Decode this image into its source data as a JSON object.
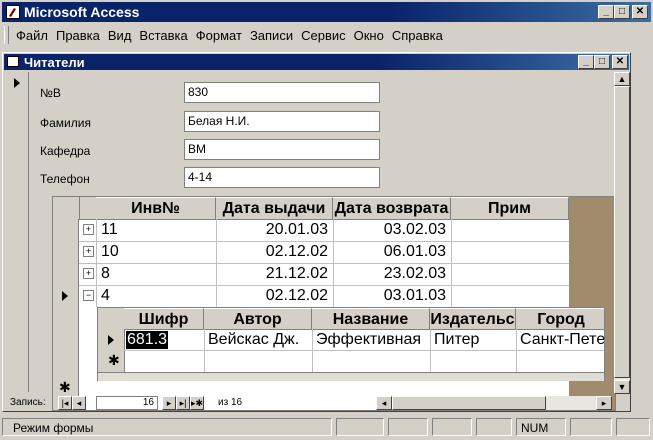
{
  "app": {
    "title": "Microsoft Access"
  },
  "menu": [
    "Файл",
    "Правка",
    "Вид",
    "Вставка",
    "Формат",
    "Записи",
    "Сервис",
    "Окно",
    "Справка"
  ],
  "form": {
    "title": "Читатели",
    "fields": [
      {
        "label": "№В",
        "value": "830"
      },
      {
        "label": "Фамилия",
        "value": "Белая Н.И."
      },
      {
        "label": "Кафедра",
        "value": "ВМ"
      },
      {
        "label": "Телефон",
        "value": "4-14"
      }
    ]
  },
  "subform": {
    "columns": [
      "Инв№",
      "Дата выдачи",
      "Дата возврата",
      "Прим"
    ],
    "rows": [
      {
        "expander": "+",
        "inv": "11",
        "issued": "20.01.03",
        "returned": "03.02.03",
        "note": ""
      },
      {
        "expander": "+",
        "inv": "10",
        "issued": "02.12.02",
        "returned": "06.01.03",
        "note": ""
      },
      {
        "expander": "+",
        "inv": "8",
        "issued": "21.12.02",
        "returned": "23.02.03",
        "note": ""
      },
      {
        "expander": "−",
        "inv": "4",
        "issued": "02.12.02",
        "returned": "03.01.03",
        "note": ""
      }
    ]
  },
  "nested": {
    "columns": [
      "Шифр",
      "Автор",
      "Название",
      "Издательс",
      "Город"
    ],
    "row": {
      "code": "681.3",
      "author": "Вейскас Дж.",
      "title": "Эффективная",
      "publisher": "Питер",
      "city": "Санкт-Пете"
    }
  },
  "nav": {
    "label": "Запись:",
    "current": "16",
    "of_label": "из 16"
  },
  "status": {
    "text": "Режим формы",
    "num": "NUM"
  },
  "colors": {
    "title_bar": "#0a246a",
    "face": "#d4d0c8",
    "dark_panel": "#a08c6c"
  }
}
